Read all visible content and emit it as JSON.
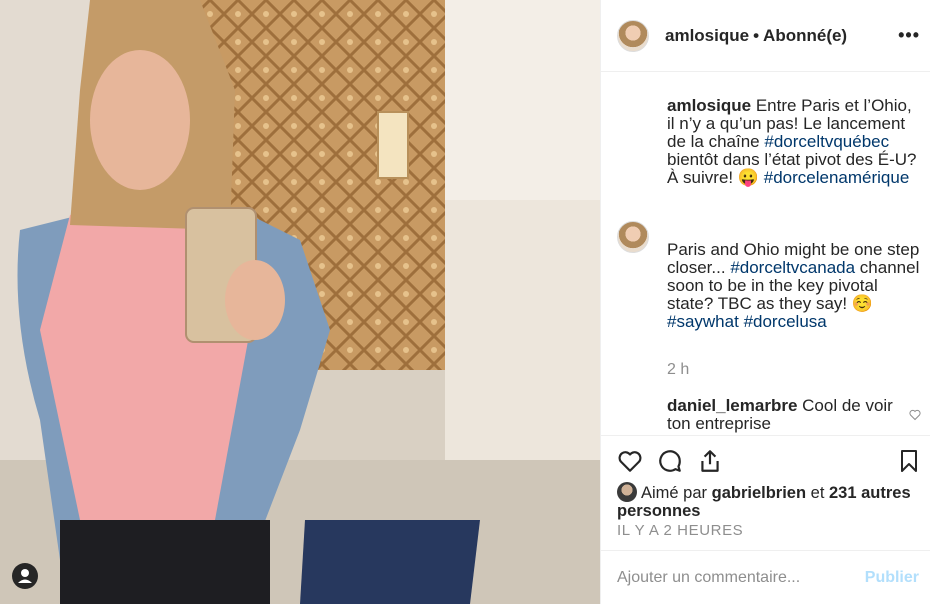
{
  "post": {
    "username": "amlosique",
    "separator": "•",
    "follow_status": "Abonné(e)",
    "more_label": "•••"
  },
  "caption": {
    "username": "amlosique",
    "text_1": " Entre Paris et l’Ohio, il n’y a qu’un pas! Le lancement de la chaîne ",
    "tag_1": "#dorceltvquébec",
    "text_2": " bientôt dans l’état pivot des É-U? À suivre! 😛 ",
    "tag_2": "#dorcelenamérique"
  },
  "reply": {
    "text_1": "Paris and Ohio might be one step closer... ",
    "tag_1": "#dorceltvcanada",
    "text_2": " channel soon to be in the key pivotal state? TBC as they say! ☺️ ",
    "tag_2": "#saywhat",
    "tag_3": "#dorcelusa",
    "time": "2 h"
  },
  "comment": {
    "username": "daniel_lemarbre",
    "text": " Cool de voir ton entreprise"
  },
  "likes": {
    "prefix": "Aimé par ",
    "user": "gabrielbrien",
    "middle": " et ",
    "others": "231 autres personnes"
  },
  "timestamp": "IL Y A 2 HEURES",
  "add_comment": {
    "placeholder": "Ajouter un commentaire...",
    "post_label": "Publier"
  },
  "icons": [
    "heart-icon",
    "comment-icon",
    "share-icon",
    "bookmark-icon",
    "user-icon"
  ]
}
